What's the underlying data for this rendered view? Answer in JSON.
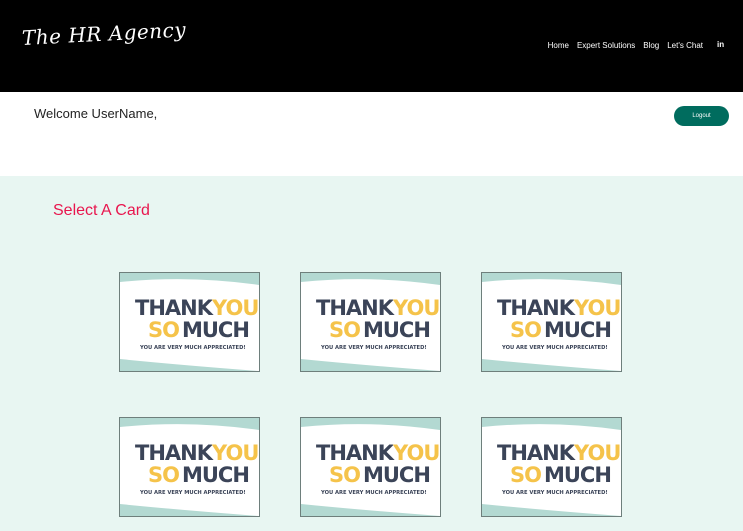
{
  "header": {
    "logo_text": "The HR Agency",
    "nav": [
      "Home",
      "Expert Solutions",
      "Blog",
      "Let's Chat"
    ],
    "social_icon_label": "in"
  },
  "welcome": {
    "text": "Welcome UserName,",
    "logout_label": "Logout"
  },
  "cards_section": {
    "title": "Select A Card",
    "card": {
      "line1_a": "THANK",
      "line1_b": "YOU",
      "line2_a": "SO",
      "line2_b": "MUCH",
      "subtitle": "YOU ARE VERY MUCH APPRECIATED!"
    },
    "card_count": 6
  },
  "colors": {
    "header_bg": "#000000",
    "section_bg": "#e8f6f2",
    "accent_title": "#e8164e",
    "logout_bg": "#006c5e",
    "card_wave": "#b3d9d2",
    "card_navy": "#3b4458",
    "card_yellow": "#f5c34a",
    "card_coral": "#ef8a7b"
  }
}
